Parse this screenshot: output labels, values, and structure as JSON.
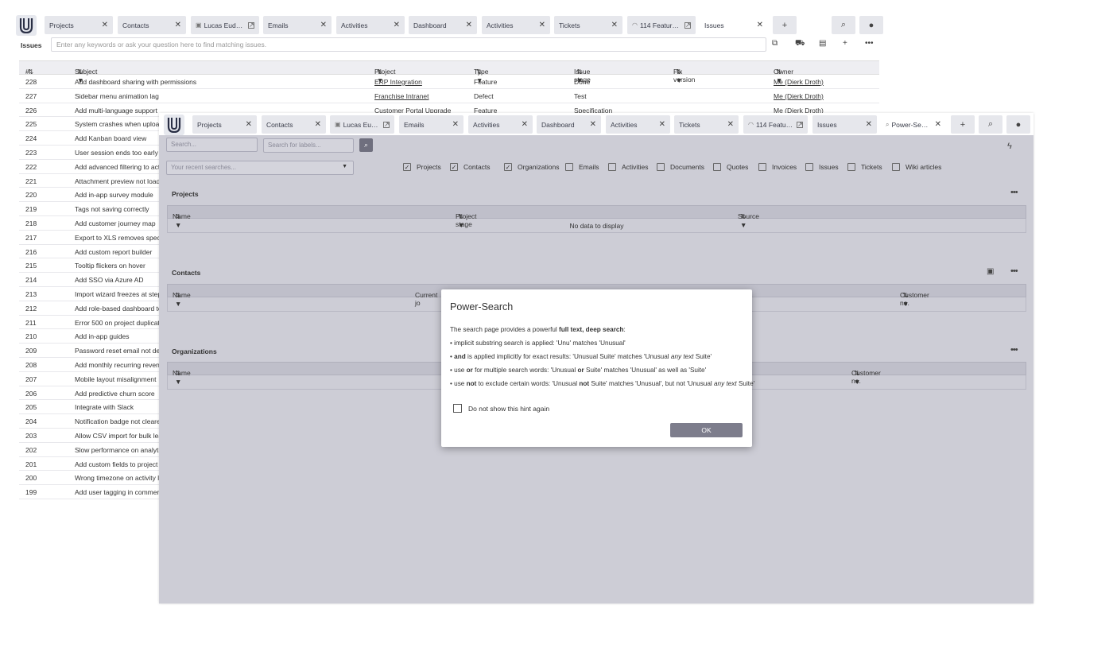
{
  "back_window": {
    "tabs": [
      {
        "label": "Projects"
      },
      {
        "label": "Contacts"
      },
      {
        "label": "Lucas Eudora..."
      },
      {
        "label": "Emails"
      },
      {
        "label": "Activities"
      },
      {
        "label": "Dashboard"
      },
      {
        "label": "Activities"
      },
      {
        "label": "Tickets"
      },
      {
        "label": "114 Feature r..."
      },
      {
        "label": "Issues"
      }
    ],
    "view_title": "Issues",
    "search_placeholder": "Enter any keywords or ask your question here to find matching issues.",
    "columns": [
      "#",
      "Subject",
      "Project",
      "Type",
      "Issue stage",
      "Fix version",
      "Owner"
    ],
    "rows": [
      {
        "id": "228",
        "subject": "Add dashboard sharing with permissions",
        "project": "ERP Integration",
        "type": "Feature",
        "stage": "Done",
        "owner": "Me (Dierk Droth)"
      },
      {
        "id": "227",
        "subject": "Sidebar menu animation lag",
        "project": "Franchise Intranet",
        "type": "Defect",
        "stage": "Test",
        "owner": "Me (Dierk Droth)"
      },
      {
        "id": "226",
        "subject": "Add multi-language support",
        "project": "Customer Portal Upgrade",
        "type": "Feature",
        "stage": "Specification",
        "owner": "Me (Dierk Droth)"
      },
      {
        "id": "225",
        "subject": "System crashes when uploadi"
      },
      {
        "id": "224",
        "subject": "Add Kanban board view"
      },
      {
        "id": "223",
        "subject": "User session ends too early"
      },
      {
        "id": "222",
        "subject": "Add advanced filtering to acti"
      },
      {
        "id": "221",
        "subject": "Attachment preview not loadi"
      },
      {
        "id": "220",
        "subject": "Add in-app survey module"
      },
      {
        "id": "219",
        "subject": "Tags not saving correctly"
      },
      {
        "id": "218",
        "subject": "Add customer journey map"
      },
      {
        "id": "217",
        "subject": "Export to XLS removes specia"
      },
      {
        "id": "216",
        "subject": "Add custom report builder"
      },
      {
        "id": "215",
        "subject": "Tooltip flickers on hover"
      },
      {
        "id": "214",
        "subject": "Add SSO via Azure AD"
      },
      {
        "id": "213",
        "subject": "Import wizard freezes at step"
      },
      {
        "id": "212",
        "subject": "Add role-based dashboard ter"
      },
      {
        "id": "211",
        "subject": "Error 500 on project duplicatio"
      },
      {
        "id": "210",
        "subject": "Add in-app guides"
      },
      {
        "id": "209",
        "subject": "Password reset email not deliv"
      },
      {
        "id": "208",
        "subject": "Add monthly recurring revenu"
      },
      {
        "id": "207",
        "subject": "Mobile layout misalignment"
      },
      {
        "id": "206",
        "subject": "Add predictive churn score"
      },
      {
        "id": "205",
        "subject": "Integrate with Slack"
      },
      {
        "id": "204",
        "subject": "Notification badge not cleared"
      },
      {
        "id": "203",
        "subject": "Allow CSV import for bulk lead"
      },
      {
        "id": "202",
        "subject": "Slow performance on analytic"
      },
      {
        "id": "201",
        "subject": "Add custom fields to project s"
      },
      {
        "id": "200",
        "subject": "Wrong timezone on activity lo"
      },
      {
        "id": "199",
        "subject": "Add user tagging in comments"
      }
    ]
  },
  "front_window": {
    "tabs": [
      {
        "label": "Projects"
      },
      {
        "label": "Contacts"
      },
      {
        "label": "Lucas Eudor..."
      },
      {
        "label": "Emails"
      },
      {
        "label": "Activities"
      },
      {
        "label": "Dashboard"
      },
      {
        "label": "Activities"
      },
      {
        "label": "Tickets"
      },
      {
        "label": "114 Feature ..."
      },
      {
        "label": "Issues"
      },
      {
        "label": "Power-Search"
      }
    ],
    "search_placeholder": "Search...",
    "labels_placeholder": "Search for labels...",
    "recent_placeholder": "Your recent searches...",
    "filters": [
      {
        "label": "Projects",
        "checked": true
      },
      {
        "label": "Contacts",
        "checked": true
      },
      {
        "label": "Organizations",
        "checked": true
      },
      {
        "label": "Emails",
        "checked": false
      },
      {
        "label": "Activities",
        "checked": false
      },
      {
        "label": "Documents",
        "checked": false
      },
      {
        "label": "Quotes",
        "checked": false
      },
      {
        "label": "Invoices",
        "checked": false
      },
      {
        "label": "Issues",
        "checked": false
      },
      {
        "label": "Tickets",
        "checked": false
      },
      {
        "label": "Wiki articles",
        "checked": false
      }
    ],
    "sections": {
      "projects": {
        "title": "Projects",
        "columns": [
          "Name",
          "Project stage",
          "Source"
        ],
        "empty": "No data to display"
      },
      "contacts": {
        "title": "Contacts",
        "columns": [
          "Name",
          "Current jo",
          "Customer no."
        ]
      },
      "organizations": {
        "title": "Organizations",
        "columns": [
          "Name",
          "Customer no."
        ]
      }
    }
  },
  "modal": {
    "title": "Power-Search",
    "intro_pre": "The search page provides a powerful ",
    "intro_bold": "full text, deep search",
    "intro_post": ":",
    "line1": "• implicit substring search is applied: 'Unu' matches 'Unusual'",
    "line2_bold": "and",
    "line2_a": " is applied implicitly for exact results: 'Unusual Suite' matches 'Unusual ",
    "line2_em": "any text",
    "line2_b": " Suite'",
    "line3_pre": "• use ",
    "line3_bold": "or",
    "line3_a": " for multiple search words: 'Unusual ",
    "line3_b": " Suite' matches 'Unusual' as well as 'Suite'",
    "line4_pre": "• use ",
    "line4_bold": "not",
    "line4_a": " to exclude certain words: 'Unusual ",
    "line4_b": " Suite' matches 'Unusual', but not 'Unusual ",
    "line4_em": "any text",
    "line4_c": " Suite'",
    "bullet": "• ",
    "checkbox_label": "Do not show this hint again",
    "ok_label": "OK"
  }
}
